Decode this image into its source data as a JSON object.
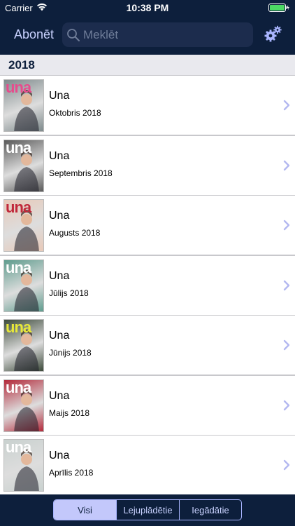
{
  "status_bar": {
    "carrier": "Carrier",
    "time": "10:38 PM"
  },
  "nav": {
    "subscribe_label": "Abonēt",
    "search_placeholder": "Meklēt",
    "settings_icon": "gears-icon"
  },
  "section": {
    "title": "2018"
  },
  "issues": [
    {
      "title": "Una",
      "date": "Oktobris 2018",
      "cover_bg": "#7e8a8c",
      "logo_color": "#e64c8d"
    },
    {
      "title": "Una",
      "date": "Septembris 2018",
      "cover_bg": "#5a5a5a",
      "logo_color": "#ffffff"
    },
    {
      "title": "Una",
      "date": "Augusts 2018",
      "cover_bg": "#e8c9b8",
      "logo_color": "#c0283a"
    },
    {
      "title": "Una",
      "date": "Jūlijs 2018",
      "cover_bg": "#5f9c8e",
      "logo_color": "#ffffff"
    },
    {
      "title": "Una",
      "date": "Jūnijs 2018",
      "cover_bg": "#3c4a3a",
      "logo_color": "#e7e839"
    },
    {
      "title": "Una",
      "date": "Maijs 2018",
      "cover_bg": "#b32a3b",
      "logo_color": "#ffffff"
    },
    {
      "title": "Una",
      "date": "Aprīlis 2018",
      "cover_bg": "#c9d1cf",
      "logo_color": "#ffffff"
    }
  ],
  "cover_logo_text": "una",
  "tabs": [
    {
      "label": "Visi",
      "active": true
    },
    {
      "label": "Lejuplādētie",
      "active": false
    },
    {
      "label": "Iegādātie",
      "active": false
    }
  ],
  "colors": {
    "nav_bg": "#0d1f3c",
    "accent": "#c3c8fb",
    "chevron": "#b3b8f0"
  }
}
